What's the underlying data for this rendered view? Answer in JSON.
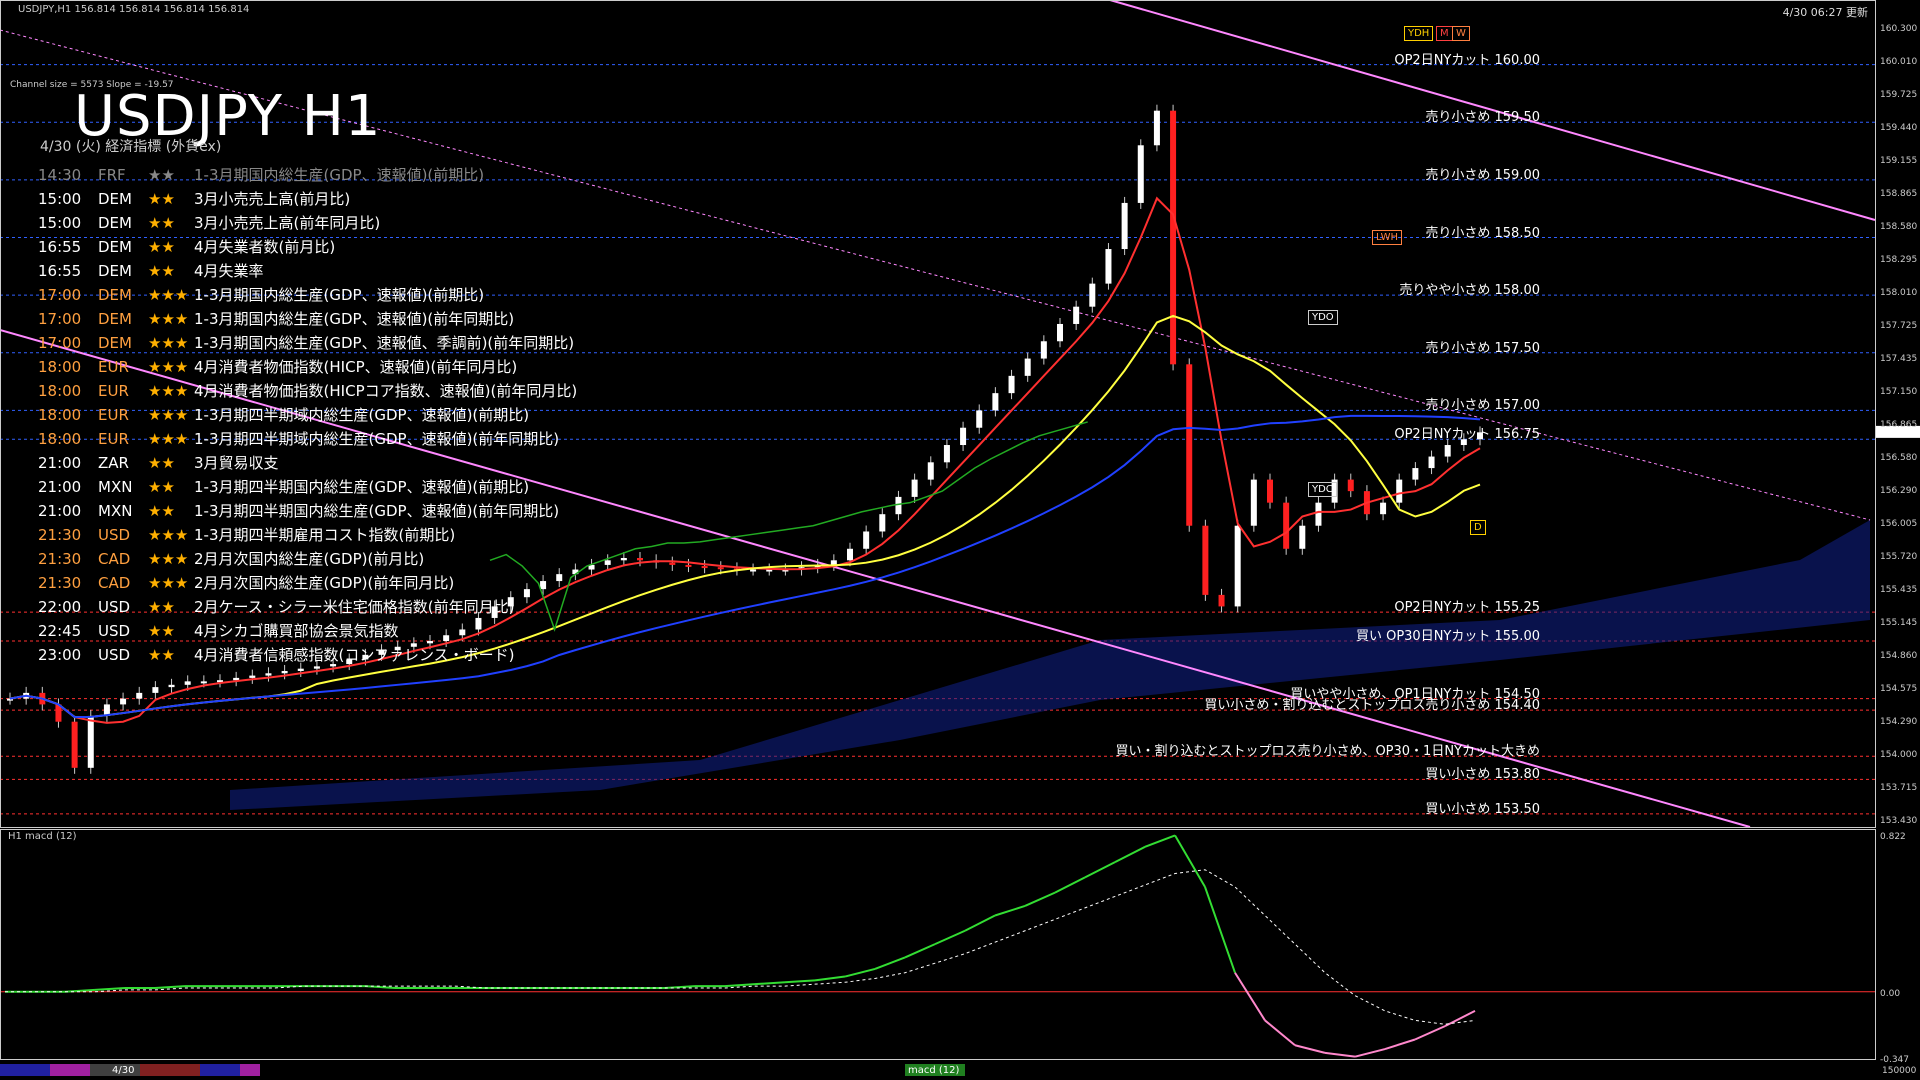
{
  "header": {
    "symbol_info": "USDJPY,H1  156.814 156.814 156.814 156.814",
    "channel_info": "Channel size = 5573 Slope = -19.57",
    "timestamp": "4/30 06:27 更新"
  },
  "title": "USDJPY H1",
  "subtitle": "4/30 (火) 経済指標 (外貨ex)",
  "calendar": [
    {
      "time": "14:30",
      "cur": "FRF",
      "stars": "★★",
      "name": "1-3月期国内総生産(GDP、速報値)(前期比)",
      "style": "past"
    },
    {
      "time": "15:00",
      "cur": "DEM",
      "stars": "★★",
      "name": "3月小売売上高(前月比)",
      "style": ""
    },
    {
      "time": "15:00",
      "cur": "DEM",
      "stars": "★★",
      "name": "3月小売売上高(前年同月比)",
      "style": ""
    },
    {
      "time": "16:55",
      "cur": "DEM",
      "stars": "★★",
      "name": "4月失業者数(前月比)",
      "style": ""
    },
    {
      "time": "16:55",
      "cur": "DEM",
      "stars": "★★",
      "name": "4月失業率",
      "style": ""
    },
    {
      "time": "17:00",
      "cur": "DEM",
      "stars": "★★★",
      "name": "1-3月期国内総生産(GDP、速報値)(前期比)",
      "style": "orange"
    },
    {
      "time": "17:00",
      "cur": "DEM",
      "stars": "★★★",
      "name": "1-3月期国内総生産(GDP、速報値)(前年同期比)",
      "style": "orange"
    },
    {
      "time": "17:00",
      "cur": "DEM",
      "stars": "★★★",
      "name": "1-3月期国内総生産(GDP、速報値、季調前)(前年同期比)",
      "style": "orange"
    },
    {
      "time": "18:00",
      "cur": "EUR",
      "stars": "★★★",
      "name": "4月消費者物価指数(HICP、速報値)(前年同月比)",
      "style": "orange"
    },
    {
      "time": "18:00",
      "cur": "EUR",
      "stars": "★★★",
      "name": "4月消費者物価指数(HICPコア指数、速報値)(前年同月比)",
      "style": "orange"
    },
    {
      "time": "18:00",
      "cur": "EUR",
      "stars": "★★★",
      "name": "1-3月期四半期域内総生産(GDP、速報値)(前期比)",
      "style": "orange"
    },
    {
      "time": "18:00",
      "cur": "EUR",
      "stars": "★★★",
      "name": "1-3月期四半期域内総生産(GDP、速報値)(前年同期比)",
      "style": "orange"
    },
    {
      "time": "21:00",
      "cur": "ZAR",
      "stars": "★★",
      "name": "3月貿易収支",
      "style": ""
    },
    {
      "time": "21:00",
      "cur": "MXN",
      "stars": "★★",
      "name": "1-3月期四半期国内総生産(GDP、速報値)(前期比)",
      "style": ""
    },
    {
      "time": "21:00",
      "cur": "MXN",
      "stars": "★★",
      "name": "1-3月期四半期国内総生産(GDP、速報値)(前年同期比)",
      "style": ""
    },
    {
      "time": "21:30",
      "cur": "USD",
      "stars": "★★★",
      "name": "1-3月期四半期雇用コスト指数(前期比)",
      "style": "orange"
    },
    {
      "time": "21:30",
      "cur": "CAD",
      "stars": "★★★",
      "name": "2月月次国内総生産(GDP)(前月比)",
      "style": "orange"
    },
    {
      "time": "21:30",
      "cur": "CAD",
      "stars": "★★★",
      "name": "2月月次国内総生産(GDP)(前年同月比)",
      "style": "orange"
    },
    {
      "time": "22:00",
      "cur": "USD",
      "stars": "★★",
      "name": "2月ケース・シラー米住宅価格指数(前年同月比)",
      "style": ""
    },
    {
      "time": "22:45",
      "cur": "USD",
      "stars": "★★",
      "name": "4月シカゴ購買部協会景気指数",
      "style": ""
    },
    {
      "time": "23:00",
      "cur": "USD",
      "stars": "★★",
      "name": "4月消費者信頼感指数(コンファレンス・ボード)",
      "style": ""
    }
  ],
  "levels": [
    {
      "label": "OP2日NYカット 160.00",
      "price": 160.0
    },
    {
      "label": "売り小さめ 159.50",
      "price": 159.5
    },
    {
      "label": "売り小さめ 159.00",
      "price": 159.0
    },
    {
      "label": "売り小さめ 158.50",
      "price": 158.5
    },
    {
      "label": "売りやや小さめ 158.00",
      "price": 158.0
    },
    {
      "label": "売り小さめ 157.50",
      "price": 157.5
    },
    {
      "label": "売り小さめ 157.00",
      "price": 157.0
    },
    {
      "label": "OP2日NYカット 156.75",
      "price": 156.75
    },
    {
      "label": "OP2日NYカット 155.25",
      "price": 155.25
    },
    {
      "label": "買い OP30日NYカット 155.00",
      "price": 155.0
    },
    {
      "label": "買いやや小さめ、OP1日NYカット 154.50",
      "price": 154.5
    },
    {
      "label": "買い小さめ・割り込むとストップロス売り小さめ 154.40",
      "price": 154.4
    },
    {
      "label": "買い・割り込むとストップロス売り小さめ、OP30・1日NYカット大きめ",
      "price": 154.0
    },
    {
      "label": "買い小さめ 153.80",
      "price": 153.8
    },
    {
      "label": "買い小さめ 153.50",
      "price": 153.5
    }
  ],
  "tags": {
    "ydh": "YDH",
    "m": "M",
    "w": "W",
    "lwh": "LWH",
    "ydo": "YDO",
    "ydc": "YDC",
    "d": "D"
  },
  "macd_label": "H1  macd (12)",
  "bottom": {
    "date": "4/30",
    "macd": "macd (12)",
    "volume": "150000"
  },
  "chart_data": {
    "type": "line",
    "title": "USDJPY H1",
    "y_axis_ticks": [
      160.3,
      160.01,
      159.725,
      159.44,
      159.155,
      158.865,
      158.58,
      158.295,
      158.01,
      157.725,
      157.435,
      157.15,
      156.865,
      156.58,
      156.29,
      156.005,
      155.72,
      155.435,
      155.145,
      154.86,
      154.575,
      154.29,
      154.0,
      153.715,
      153.43
    ],
    "ylim": [
      153.43,
      160.3
    ],
    "current_price": 156.814,
    "series": [
      {
        "name": "close",
        "color": "#ffffff",
        "values": [
          154.5,
          154.55,
          154.45,
          154.3,
          153.9,
          154.35,
          154.45,
          154.5,
          154.55,
          154.6,
          154.62,
          154.65,
          154.65,
          154.66,
          154.68,
          154.7,
          154.72,
          154.74,
          154.76,
          154.78,
          154.8,
          154.84,
          154.88,
          154.92,
          154.95,
          154.98,
          155.0,
          155.05,
          155.1,
          155.2,
          155.3,
          155.38,
          155.45,
          155.52,
          155.58,
          155.62,
          155.66,
          155.7,
          155.72,
          155.7,
          155.68,
          155.66,
          155.65,
          155.64,
          155.63,
          155.62,
          155.62,
          155.62,
          155.62,
          155.64,
          155.66,
          155.7,
          155.8,
          155.95,
          156.1,
          156.25,
          156.4,
          156.55,
          156.7,
          156.85,
          157.0,
          157.15,
          157.3,
          157.45,
          157.6,
          157.75,
          157.9,
          158.1,
          158.4,
          158.8,
          159.3,
          159.6,
          157.4,
          156.0,
          155.4,
          155.3,
          156.0,
          156.4,
          156.2,
          155.8,
          156.0,
          156.2,
          156.4,
          156.3,
          156.1,
          156.2,
          156.4,
          156.5,
          156.6,
          156.7,
          156.75,
          156.81
        ]
      },
      {
        "name": "macd",
        "color": "#33dd33",
        "values": [
          0.0,
          0.0,
          0.0,
          0.01,
          0.02,
          0.02,
          0.03,
          0.03,
          0.03,
          0.03,
          0.03,
          0.03,
          0.03,
          0.02,
          0.02,
          0.02,
          0.02,
          0.02,
          0.02,
          0.02,
          0.02,
          0.02,
          0.02,
          0.03,
          0.03,
          0.04,
          0.05,
          0.06,
          0.08,
          0.12,
          0.18,
          0.25,
          0.32,
          0.4,
          0.45,
          0.52,
          0.6,
          0.68,
          0.76,
          0.82,
          0.55,
          0.1,
          -0.15,
          -0.28,
          -0.32,
          -0.34,
          -0.3,
          -0.25,
          -0.18,
          -0.1
        ]
      },
      {
        "name": "macd_signal",
        "color": "#ffffff",
        "values": [
          0.0,
          0.0,
          0.0,
          0.0,
          0.01,
          0.01,
          0.02,
          0.02,
          0.02,
          0.02,
          0.03,
          0.03,
          0.03,
          0.03,
          0.03,
          0.03,
          0.02,
          0.02,
          0.02,
          0.02,
          0.02,
          0.02,
          0.02,
          0.02,
          0.02,
          0.03,
          0.03,
          0.04,
          0.05,
          0.07,
          0.1,
          0.15,
          0.2,
          0.26,
          0.32,
          0.38,
          0.44,
          0.5,
          0.56,
          0.62,
          0.64,
          0.55,
          0.4,
          0.25,
          0.1,
          -0.02,
          -0.1,
          -0.15,
          -0.17,
          -0.15
        ]
      }
    ],
    "macd_ylim": [
      -0.347,
      0.822
    ],
    "macd_ticks": [
      0.822,
      0.0,
      -0.347
    ]
  }
}
